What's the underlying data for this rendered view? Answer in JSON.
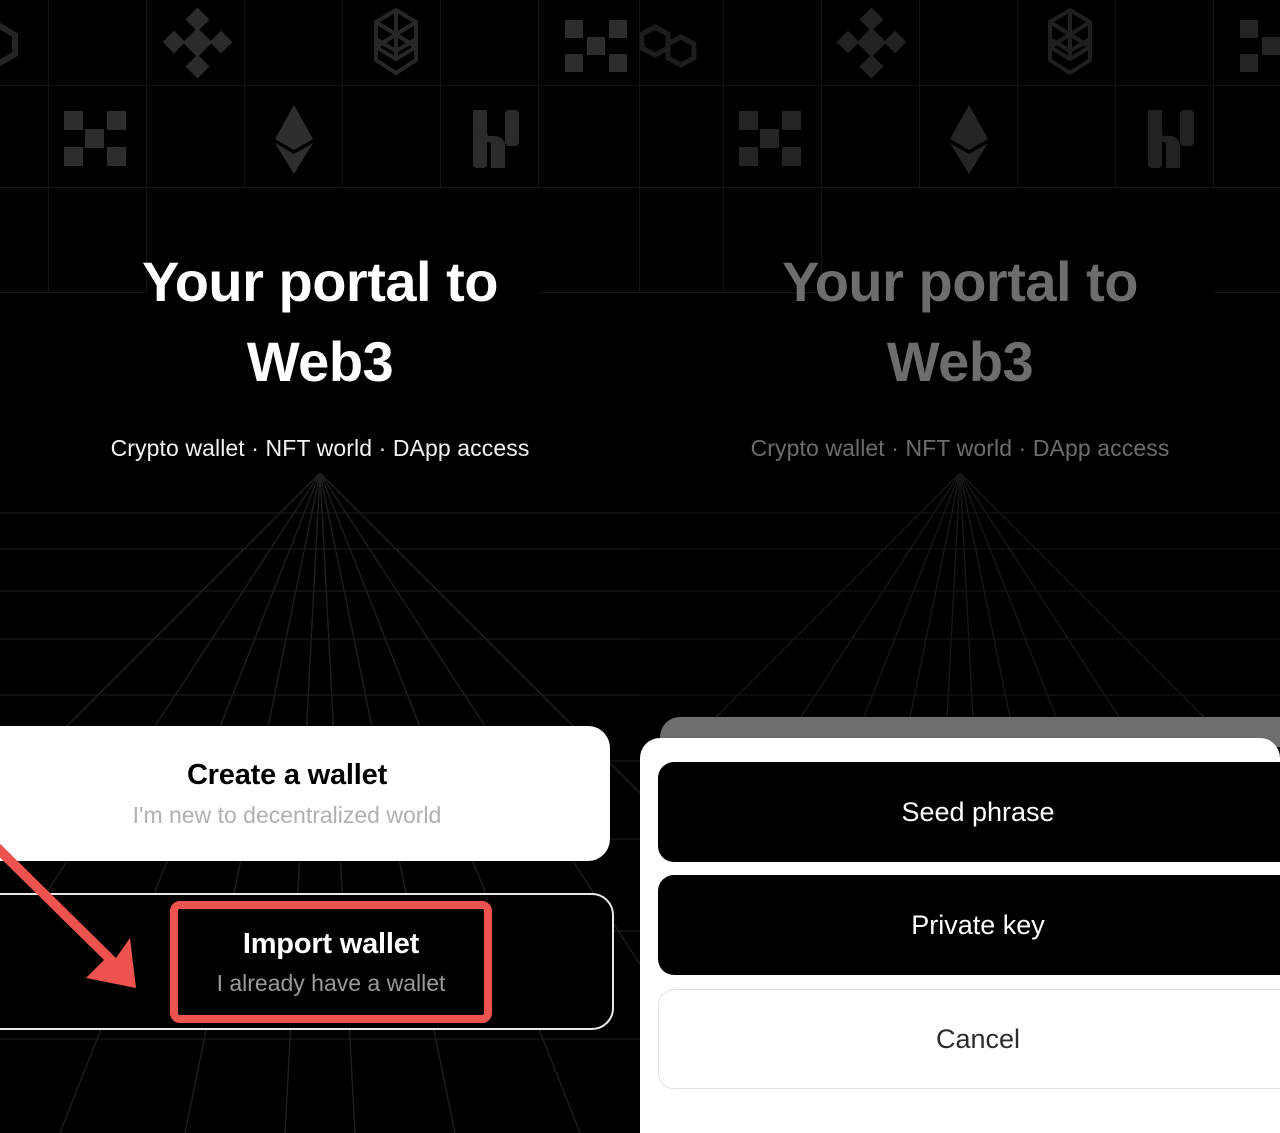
{
  "hero": {
    "title": "Your portal to\nWeb3",
    "subtitle": "Crypto wallet · NFT world · DApp access"
  },
  "left_screen": {
    "create_wallet": {
      "title": "Create a wallet",
      "subtitle": "I'm new to decentralized world"
    },
    "import_wallet": {
      "title": "Import wallet",
      "subtitle": "I already have a wallet"
    },
    "annotation": {
      "shape": "arrow-pointing-down-right",
      "target": "Import wallet",
      "color": "#ED5450"
    }
  },
  "right_screen": {
    "action_sheet": {
      "options": [
        {
          "label": "Seed phrase",
          "style": "dark"
        },
        {
          "label": "Private key",
          "style": "dark"
        },
        {
          "label": "Cancel",
          "style": "light"
        }
      ]
    },
    "backdrop_dimmed": true
  },
  "background": {
    "chain_icons": [
      "polygon-icon",
      "binance-icon",
      "fantom-icon",
      "okx-icon",
      "okx-icon",
      "ethereum-icon",
      "arbitrum-icon",
      "okx-icon"
    ],
    "floor": "perspective-grid"
  },
  "colors": {
    "background": "#000000",
    "card_surface": "#FFFFFF",
    "accent_highlight": "#ED5450",
    "muted_text": "#B0B0B0",
    "dimmed_text": "#6D6D6D",
    "sheet_shadow": "#6E6E6E"
  }
}
